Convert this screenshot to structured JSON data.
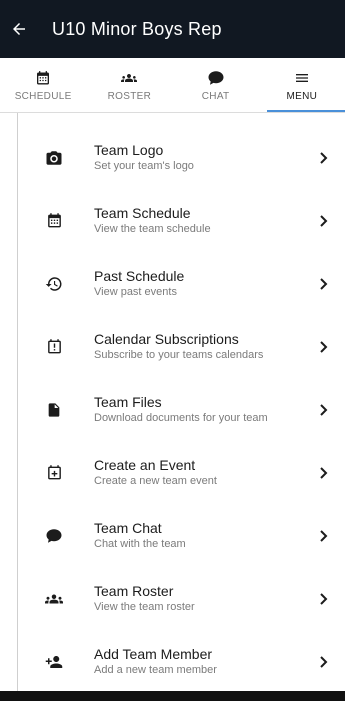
{
  "header": {
    "title": "U10 Minor Boys Rep",
    "back_icon": "arrow-left-icon"
  },
  "tabs": [
    {
      "label": "SCHEDULE",
      "icon": "calendar-icon",
      "active": false
    },
    {
      "label": "ROSTER",
      "icon": "people-icon",
      "active": false
    },
    {
      "label": "CHAT",
      "icon": "chat-bubble-icon",
      "active": false
    },
    {
      "label": "MENU",
      "icon": "menu-icon",
      "active": true
    }
  ],
  "menu": {
    "items": [
      {
        "title": "Team Logo",
        "subtitle": "Set your team's logo",
        "icon": "camera-icon"
      },
      {
        "title": "Team Schedule",
        "subtitle": "View the team schedule",
        "icon": "calendar-icon"
      },
      {
        "title": "Past Schedule",
        "subtitle": "View past events",
        "icon": "history-icon"
      },
      {
        "title": "Calendar Subscriptions",
        "subtitle": "Subscribe to your teams calendars",
        "icon": "calendar-alert-icon"
      },
      {
        "title": "Team Files",
        "subtitle": "Download documents for your team",
        "icon": "file-icon"
      },
      {
        "title": "Create an Event",
        "subtitle": "Create a new team event",
        "icon": "calendar-plus-icon"
      },
      {
        "title": "Team Chat",
        "subtitle": "Chat with the team",
        "icon": "chat-bubble-icon"
      },
      {
        "title": "Team Roster",
        "subtitle": "View the team roster",
        "icon": "people-icon"
      },
      {
        "title": "Add Team Member",
        "subtitle": "Add a new team member",
        "icon": "person-add-icon"
      }
    ]
  },
  "colors": {
    "appbar": "#111822",
    "active_underline": "#4a90d9",
    "subtitle": "#7b7b7b"
  }
}
